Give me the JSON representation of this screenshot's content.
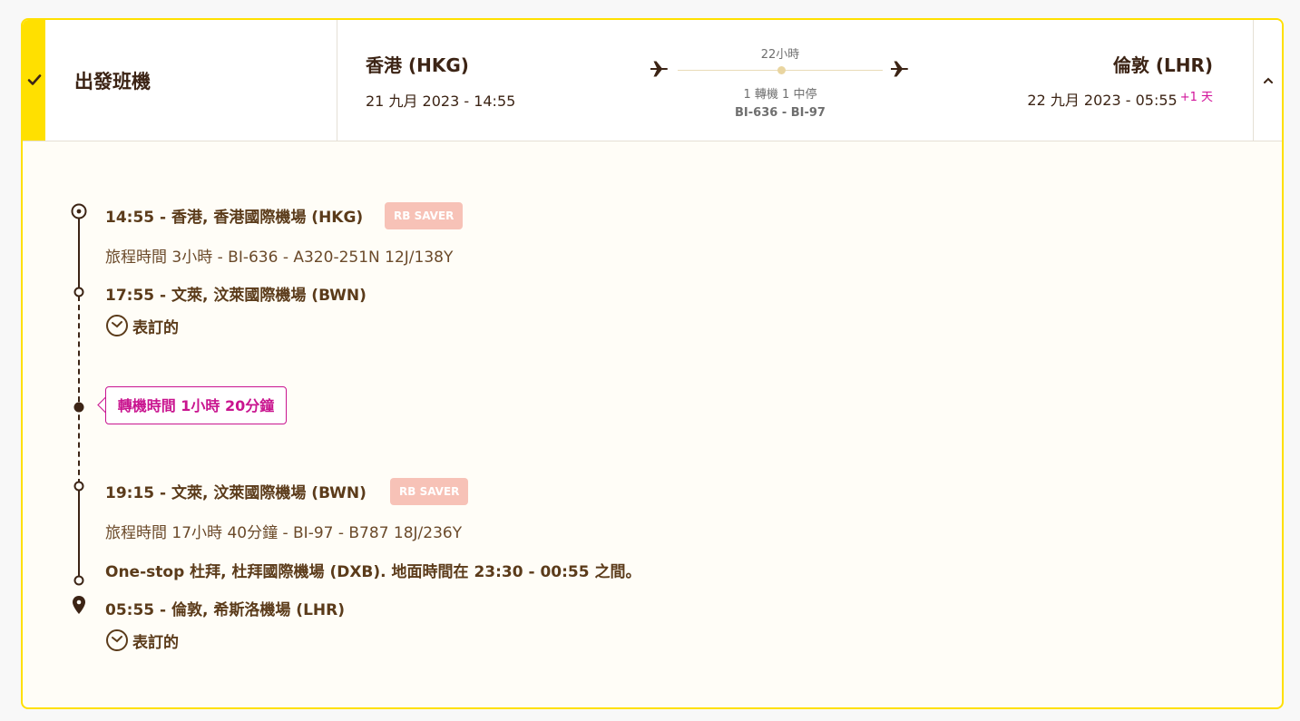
{
  "header": {
    "title": "出發班機",
    "origin": {
      "city": "香港 (HKG)",
      "datetime": "21 九月 2023 - 14:55"
    },
    "destination": {
      "city": "倫敦 (LHR)",
      "datetime": "22 九月 2023 - 05:55",
      "day_offset": "+1 天"
    },
    "route": {
      "duration": "22小時",
      "stops": "1 轉機 1 中停",
      "flights": "BI-636 - BI-97"
    }
  },
  "itinerary": {
    "segment1": {
      "departure": "14:55 - 香港, 香港國際機場 (HKG)",
      "fare_badge": "RB SAVER",
      "details": "旅程時間 3小時 - BI-636 - A320-251N 12J/138Y",
      "arrival": "17:55 - 文萊, 汶萊國際機場 (BWN)",
      "status": "表訂的"
    },
    "connection": {
      "label": "轉機時間 1小時 20分鐘"
    },
    "segment2": {
      "departure": "19:15 - 文萊, 汶萊國際機場 (BWN)",
      "fare_badge": "RB SAVER",
      "details": "旅程時間 17小時 40分鐘 - BI-97 - B787 18J/236Y",
      "stop_note": "One-stop 杜拜, 杜拜國際機場 (DXB). 地面時間在 23:30 - 00:55 之間。",
      "arrival": "05:55 - 倫敦, 希斯洛機場 (LHR)",
      "status": "表訂的"
    }
  },
  "colors": {
    "accent": "#ffe000",
    "text_brown": "#5b3b1a",
    "badge": "#f7c2b7",
    "connection": "#c9148f",
    "day_offset": "#d1129a"
  },
  "icons": [
    "check-icon",
    "plane-icon",
    "chevron-up-icon",
    "origin-target-icon",
    "clock-icon",
    "destination-pin-icon"
  ]
}
